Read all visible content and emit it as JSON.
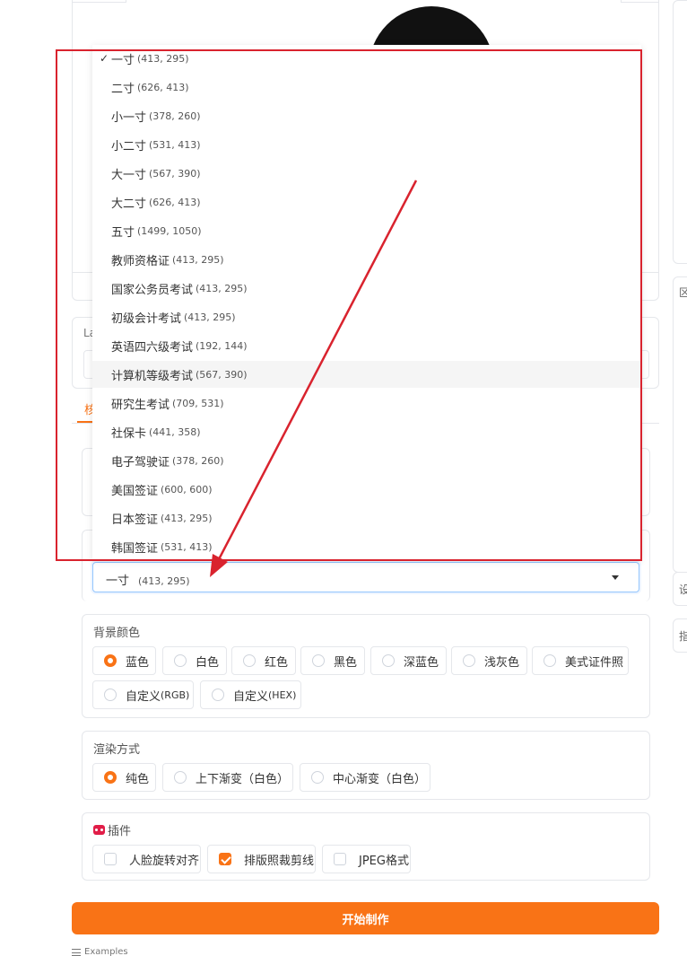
{
  "right_panel": {
    "hint_char_1": "设",
    "hint_char_2": "指",
    "top_hint": "区"
  },
  "language": {
    "label": "La"
  },
  "tabs": [
    {
      "label": "核"
    }
  ],
  "size": {
    "selected_name": "一寸",
    "selected_dims": "(413, 295)",
    "check_mark": "✓",
    "options": [
      {
        "name": "一寸",
        "dims": "(413, 295)"
      },
      {
        "name": "二寸",
        "dims": "(626, 413)"
      },
      {
        "name": "小一寸",
        "dims": "(378, 260)"
      },
      {
        "name": "小二寸",
        "dims": "(531, 413)"
      },
      {
        "name": "大一寸",
        "dims": "(567, 390)"
      },
      {
        "name": "大二寸",
        "dims": "(626, 413)"
      },
      {
        "name": "五寸",
        "dims": "(1499, 1050)"
      },
      {
        "name": "教师资格证",
        "dims": "(413, 295)"
      },
      {
        "name": "国家公务员考试",
        "dims": "(413, 295)"
      },
      {
        "name": "初级会计考试",
        "dims": "(413, 295)"
      },
      {
        "name": "英语四六级考试",
        "dims": "(192, 144)"
      },
      {
        "name": "计算机等级考试",
        "dims": "(567, 390)"
      },
      {
        "name": "研究生考试",
        "dims": "(709, 531)"
      },
      {
        "name": "社保卡",
        "dims": "(441, 358)"
      },
      {
        "name": "电子驾驶证",
        "dims": "(378, 260)"
      },
      {
        "name": "美国签证",
        "dims": "(600, 600)"
      },
      {
        "name": "日本签证",
        "dims": "(413, 295)"
      },
      {
        "name": "韩国签证",
        "dims": "(531, 413)"
      }
    ]
  },
  "background": {
    "title": "背景颜色",
    "options": [
      "蓝色",
      "白色",
      "红色",
      "黑色",
      "深蓝色",
      "浅灰色",
      "美式证件照"
    ],
    "custom_rgb_main": "自定义",
    "custom_rgb_suffix": "(RGB)",
    "custom_hex_main": "自定义",
    "custom_hex_suffix": "(HEX)",
    "selected": "蓝色"
  },
  "render": {
    "title": "渲染方式",
    "options": [
      "纯色",
      "上下渐变（白色）",
      "中心渐变（白色）"
    ],
    "selected": "纯色"
  },
  "plugins": {
    "title": "插件",
    "options": [
      "人脸旋转对齐",
      "排版照裁剪线",
      "JPEG格式"
    ],
    "checked": [
      "排版照裁剪线"
    ]
  },
  "start_button": "开始制作",
  "examples_label": "Examples",
  "colors": {
    "accent": "#f97316",
    "annotation": "#d9232e",
    "focus_border": "#93c5fd"
  }
}
